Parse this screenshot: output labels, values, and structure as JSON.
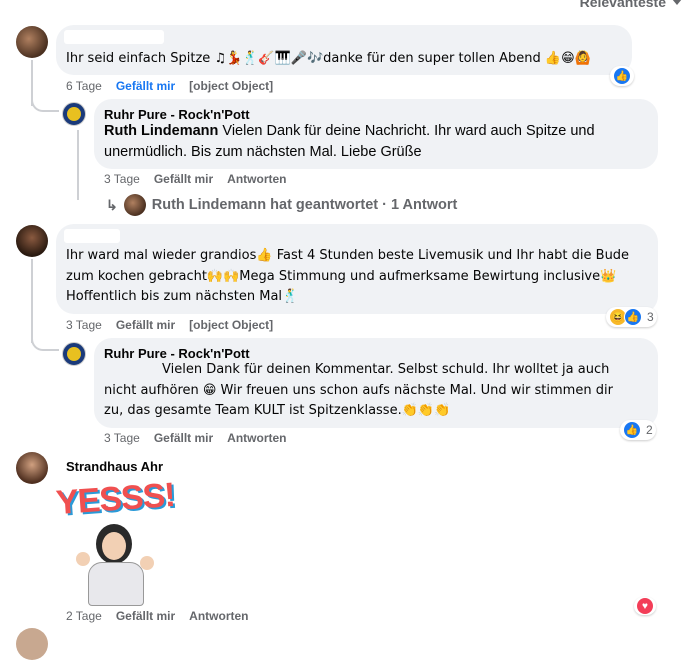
{
  "sort": {
    "label": "Relevanteste"
  },
  "comments": [
    {
      "text": "Ihr seid einfach Spitze ♫💃🕺🎸🎹🎤🎶danke für den super tollen Abend 👍😁🙆",
      "time": "6 Tage",
      "like": "Gefällt mir",
      "reply": {
        "author": "Ruhr Pure - Rock'n'Pott",
        "mention": "Ruth Lindemann",
        "text_line1": " Vielen Dank für deine Nachricht. Ihr ward auch Spitze und",
        "text_line2": "unermüdlich. Bis zum nächsten Mal. Liebe Grüße",
        "time": "3 Tage",
        "like": "Gefällt mir",
        "reply": "Antworten",
        "replied_summary": "Ruth Lindemann hat geantwortet · 1 Antwort"
      },
      "reaction_count": ""
    },
    {
      "text_line1": "Ihr ward mal wieder grandios👍 Fast 4 Stunden beste Livemusik und Ihr habt die Bude",
      "text_line2": "zum kochen gebracht🙌🙌Mega Stimmung und aufmerksame Bewirtung inclusive👑",
      "text_line3": "Hoffentlich bis zum nächsten Mal🕺",
      "time": "3 Tage",
      "like": "Gefällt mir",
      "reply": {
        "author": "Ruhr Pure - Rock'n'Pott",
        "text_line1": "Vielen Dank für deinen Kommentar. Selbst schuld. Ihr wolltet ja auch",
        "text_line2": "nicht aufhören 😁 Wir freuen uns schon aufs nächste Mal. Und wir stimmen dir",
        "text_line3": "zu, das gesamte Team KULT ist Spitzenklasse.👏👏👏",
        "time": "3 Tage",
        "like": "Gefällt mir",
        "reply": "Antworten",
        "reaction_count": "2"
      },
      "reaction_count": "3"
    },
    {
      "author": "Strandhaus Ahr",
      "sticker_text": "YESSS!",
      "time": "2 Tage",
      "like": "Gefällt mir",
      "reply": "Antworten"
    }
  ],
  "colors": {
    "like_blue": "#1877f2",
    "bubble_bg": "#f0f2f5",
    "meta_grey": "#65676b"
  }
}
